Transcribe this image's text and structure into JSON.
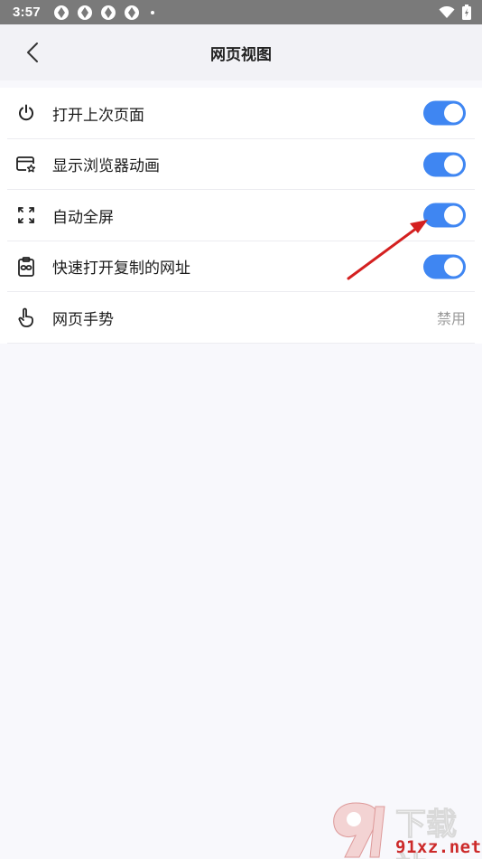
{
  "status_bar": {
    "time": "3:57"
  },
  "header": {
    "title": "网页视图"
  },
  "settings": {
    "items": [
      {
        "label": "打开上次页面",
        "icon": "power-icon",
        "toggle_on": true
      },
      {
        "label": "显示浏览器动画",
        "icon": "browser-star-icon",
        "toggle_on": true
      },
      {
        "label": "自动全屏",
        "icon": "fullscreen-icon",
        "toggle_on": true
      },
      {
        "label": "快速打开复制的网址",
        "icon": "clipboard-link-icon",
        "toggle_on": true
      },
      {
        "label": "网页手势",
        "icon": "gesture-hand-icon",
        "value": "禁用"
      }
    ]
  },
  "colors": {
    "accent": "#3f86f2",
    "annotation_arrow": "#d42020",
    "status_bar": "#7a7a7a"
  },
  "watermark": {
    "title": "下载站",
    "domain": "91xz.net"
  }
}
